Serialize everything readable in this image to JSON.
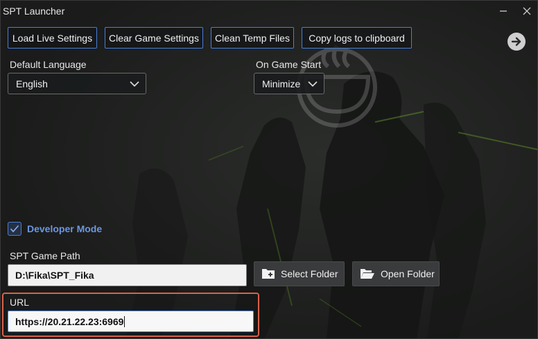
{
  "window": {
    "title": "SPT Launcher"
  },
  "toolbar": {
    "load_live_settings": "Load Live Settings",
    "clear_game_settings": "Clear Game Settings",
    "clean_temp_files": "Clean Temp Files",
    "copy_logs": "Copy logs to clipboard"
  },
  "settings": {
    "language_label": "Default Language",
    "language_value": "English",
    "on_game_start_label": "On Game Start",
    "on_game_start_value": "Minimize",
    "developer_mode_label": "Developer Mode",
    "developer_mode_checked": true,
    "game_path_label": "SPT Game Path",
    "game_path_value": "D:\\Fika\\SPT_Fika",
    "select_folder_label": "Select Folder",
    "open_folder_label": "Open Folder",
    "url_label": "URL",
    "url_value": "https://20.21.22.23:6969"
  },
  "colors": {
    "accent": "#4a7fd8",
    "developer_mode_text": "#6b97e3",
    "highlight": "#d9614a"
  },
  "icons": {
    "next": "arrow-right-icon",
    "chevron": "chevron-down-icon",
    "checkmark": "checkmark-icon",
    "select_folder": "folder-add-icon",
    "open_folder": "folder-open-icon",
    "minimize": "minimize-icon",
    "close": "close-icon"
  }
}
